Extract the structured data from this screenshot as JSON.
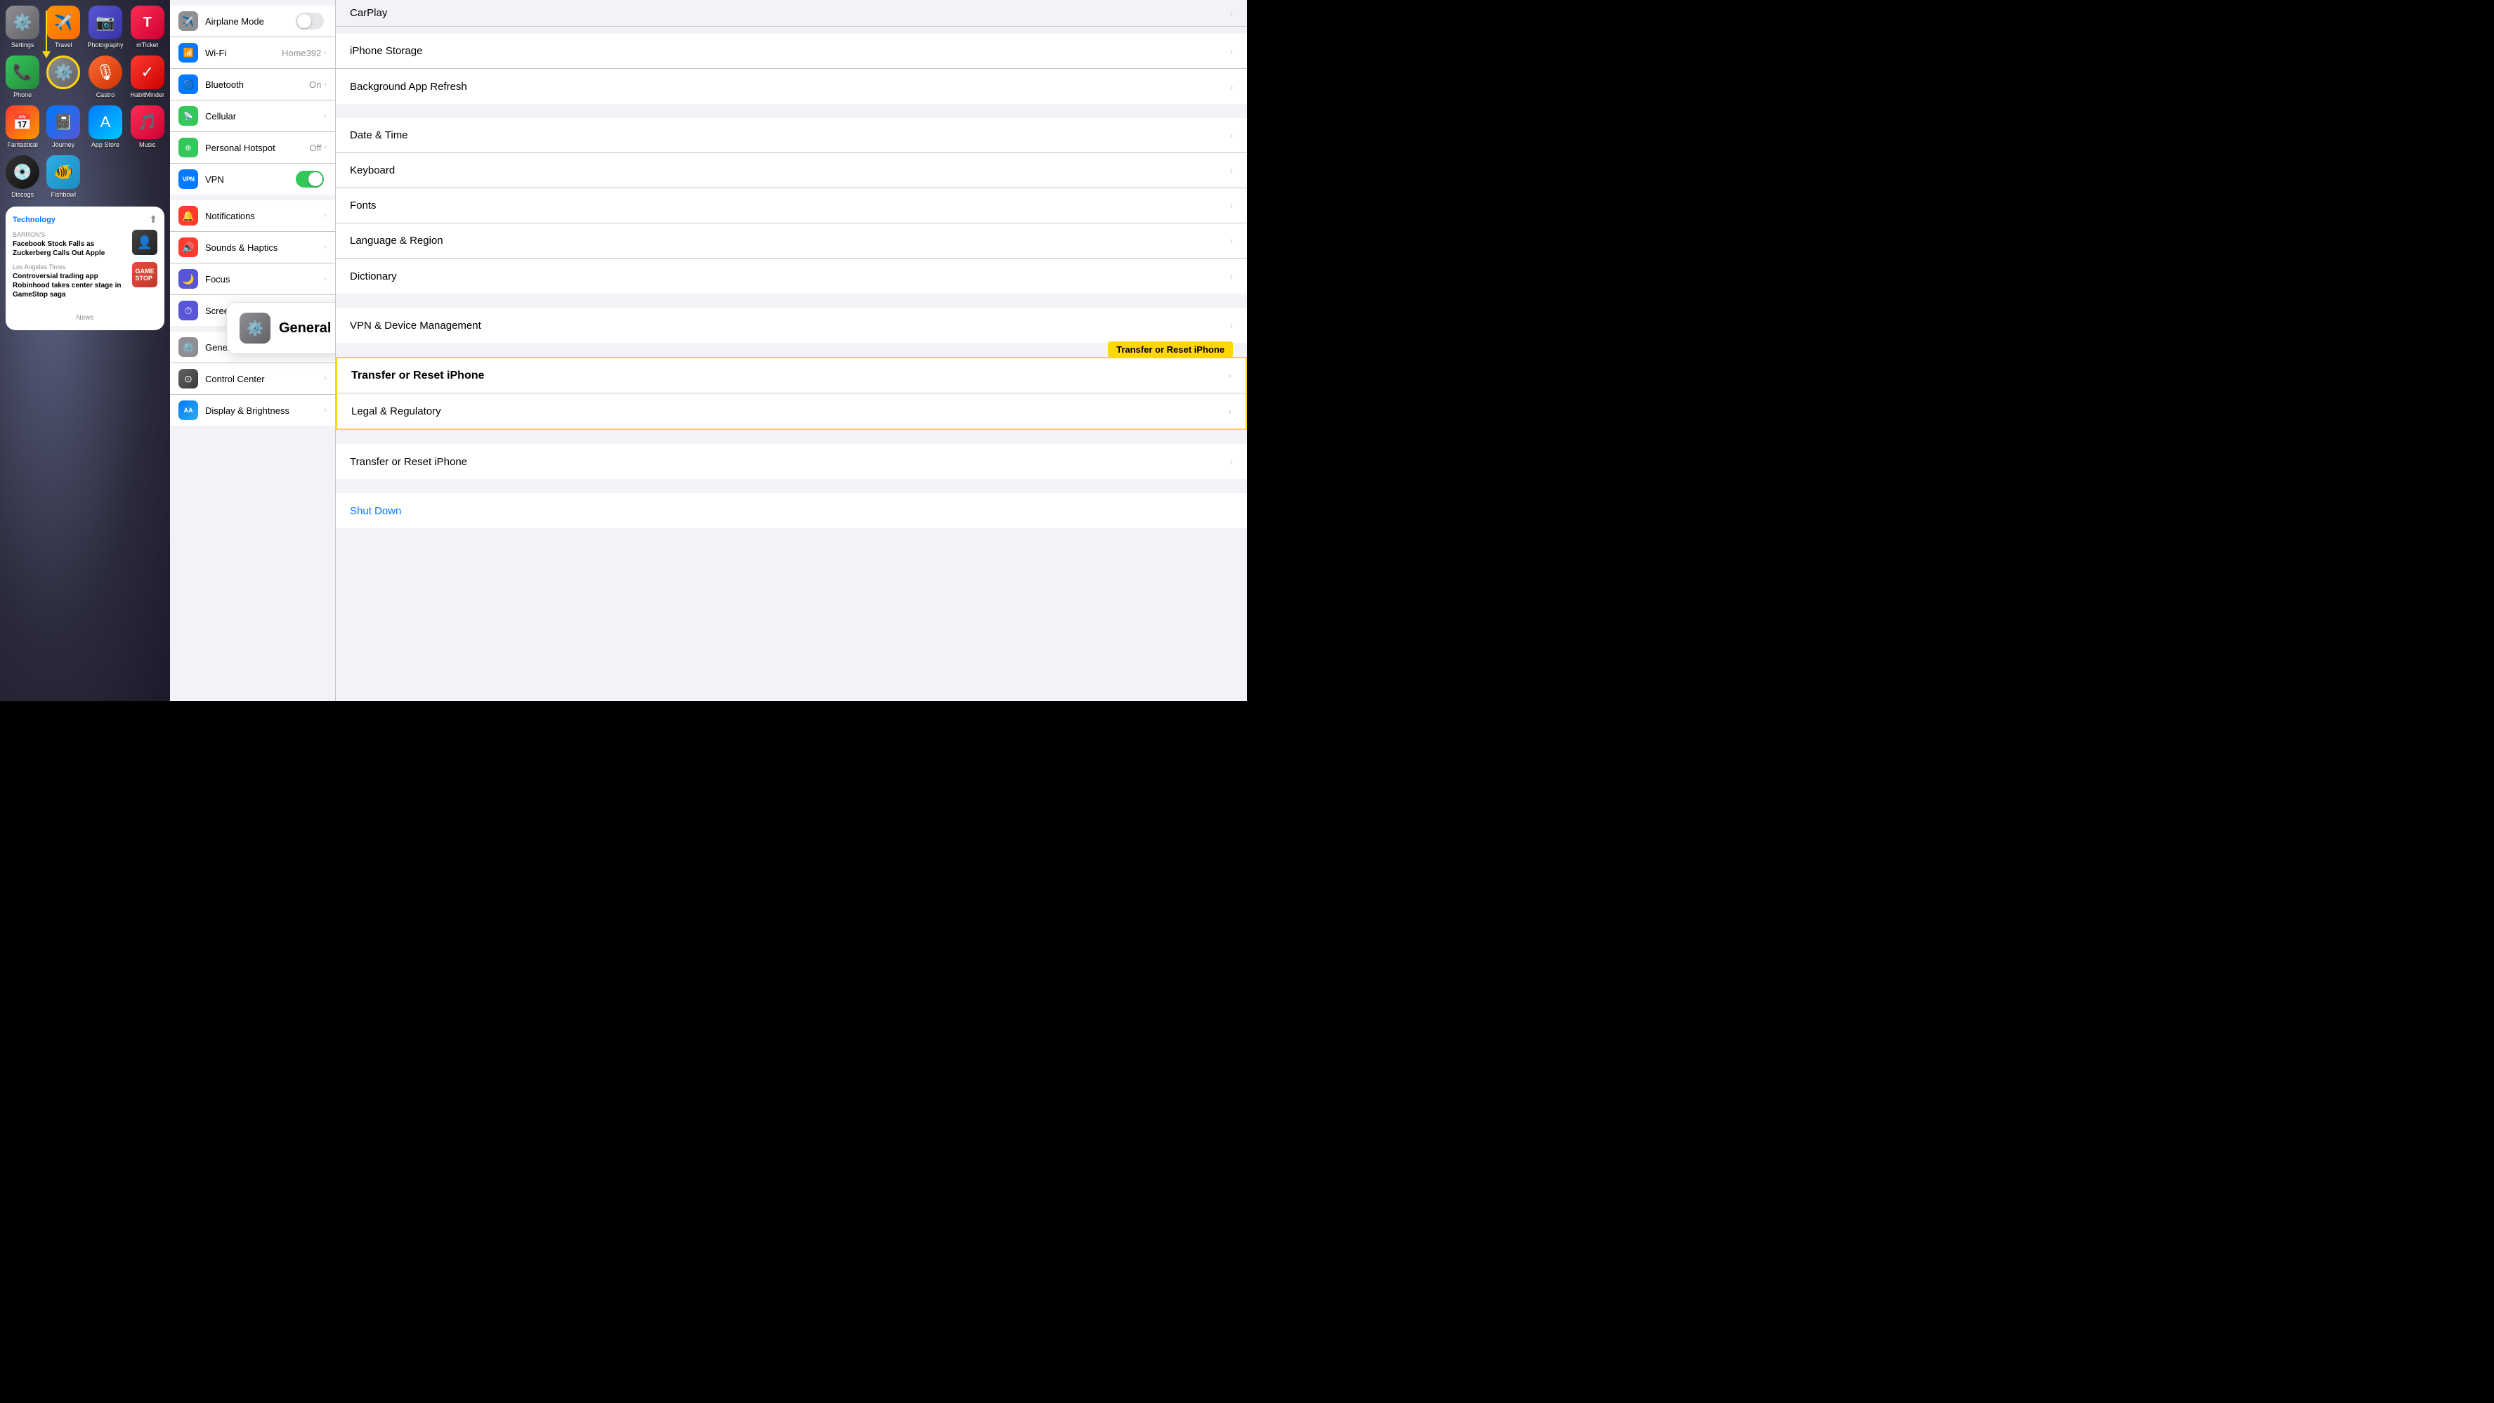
{
  "leftPanel": {
    "apps": [
      {
        "name": "Settings",
        "label": "Settings",
        "icon": "⚙️",
        "iconClass": "icon-settings"
      },
      {
        "name": "Travel",
        "label": "Travel",
        "icon": "✈️",
        "iconClass": "icon-travel"
      },
      {
        "name": "Photography",
        "label": "Photography",
        "icon": "📷",
        "iconClass": "icon-photography"
      },
      {
        "name": "mTicket",
        "label": "mTicket",
        "icon": "T",
        "iconClass": "icon-mticket"
      },
      {
        "name": "Phone",
        "label": "Phone",
        "icon": "📞",
        "iconClass": "icon-phone"
      },
      {
        "name": "SettingsHighlight",
        "label": "",
        "icon": "⚙️",
        "iconClass": "icon-settings-circled"
      },
      {
        "name": "Castro",
        "label": "Castro",
        "icon": "🎙",
        "iconClass": "icon-castro"
      },
      {
        "name": "HabitMinder",
        "label": "HabitMinder",
        "icon": "✓",
        "iconClass": "icon-habitminder"
      },
      {
        "name": "Fantastical",
        "label": "Fantastical",
        "icon": "📅",
        "iconClass": "icon-fantastical"
      },
      {
        "name": "Journey",
        "label": "Journey",
        "icon": "🐟",
        "iconClass": "icon-journey"
      },
      {
        "name": "AppStore",
        "label": "App Store",
        "icon": "A",
        "iconClass": "icon-appstore"
      },
      {
        "name": "Music",
        "label": "Music",
        "icon": "🎵",
        "iconClass": "icon-music"
      },
      {
        "name": "Discogs",
        "label": "Discogs",
        "icon": "💿",
        "iconClass": "icon-discogs"
      },
      {
        "name": "Fishbowl",
        "label": "Fishbowl",
        "icon": "🐠",
        "iconClass": "icon-fishbowl"
      }
    ],
    "news": {
      "category": "Technology",
      "source1": "BARRON'S",
      "headline1": "Facebook Stock Falls as Zuckerberg Calls Out Apple",
      "source2": "Los Angeles Times",
      "headline2": "Controversial trading app Robinhood takes center stage in GameStop saga",
      "widgetLabel": "News"
    },
    "pageDots": [
      false,
      true,
      false
    ]
  },
  "middlePanel": {
    "sections": [
      {
        "rows": [
          {
            "icon": "✈️",
            "iconClass": "icon-airplane",
            "label": "Airplane Mode",
            "type": "toggle-off",
            "value": "",
            "hasChevron": false
          },
          {
            "icon": "📶",
            "iconClass": "icon-wifi",
            "label": "Wi-Fi",
            "type": "value",
            "value": "Home392",
            "hasChevron": true
          },
          {
            "icon": "🔵",
            "iconClass": "icon-bluetooth",
            "label": "Bluetooth",
            "type": "value",
            "value": "On",
            "hasChevron": true
          },
          {
            "icon": "📡",
            "iconClass": "icon-cellular",
            "label": "Cellular",
            "type": "chevron",
            "value": "",
            "hasChevron": true
          },
          {
            "icon": "🔗",
            "iconClass": "icon-hotspot",
            "label": "Personal Hotspot",
            "type": "value",
            "value": "Off",
            "hasChevron": true
          },
          {
            "icon": "VPN",
            "iconClass": "icon-vpn",
            "label": "VPN",
            "type": "toggle-on",
            "value": "",
            "hasChevron": false
          }
        ]
      },
      {
        "rows": [
          {
            "icon": "🔔",
            "iconClass": "icon-notifications",
            "label": "Notifications",
            "type": "chevron",
            "value": "",
            "hasChevron": true
          },
          {
            "icon": "🔊",
            "iconClass": "icon-sounds",
            "label": "Sounds & Haptics",
            "type": "chevron",
            "value": "",
            "hasChevron": true
          },
          {
            "icon": "🌙",
            "iconClass": "icon-focus",
            "label": "Focus",
            "type": "chevron",
            "value": "",
            "hasChevron": true
          },
          {
            "icon": "⏱",
            "iconClass": "icon-screentime",
            "label": "Screen Time",
            "type": "chevron",
            "value": "",
            "hasChevron": true
          }
        ]
      },
      {
        "rows": [
          {
            "icon": "⚙️",
            "iconClass": "icon-general",
            "label": "General",
            "type": "chevron",
            "value": "",
            "hasChevron": true
          },
          {
            "icon": "⊙",
            "iconClass": "icon-controlcenter",
            "label": "Control Center",
            "type": "chevron",
            "value": "",
            "hasChevron": true
          },
          {
            "icon": "AA",
            "iconClass": "icon-display",
            "label": "Display & Brightness",
            "type": "chevron",
            "value": "",
            "hasChevron": true
          }
        ]
      }
    ],
    "generalTooltip": {
      "label": "General",
      "iconText": "⚙️"
    }
  },
  "rightPanel": {
    "topRow": {
      "label": "CarPlay",
      "hasChevron": true
    },
    "sections": [
      {
        "rows": [
          {
            "label": "iPhone Storage",
            "hasChevron": true
          },
          {
            "label": "Background App Refresh",
            "hasChevron": true
          }
        ]
      },
      {
        "rows": [
          {
            "label": "Date & Time",
            "hasChevron": true
          },
          {
            "label": "Keyboard",
            "hasChevron": true
          },
          {
            "label": "Fonts",
            "hasChevron": true
          },
          {
            "label": "Language & Region",
            "hasChevron": true
          },
          {
            "label": "Dictionary",
            "hasChevron": true
          }
        ]
      },
      {
        "rows": [
          {
            "label": "VPN & Device Management",
            "hasChevron": true
          }
        ]
      },
      {
        "rows": [
          {
            "label": "Transfer or Reset iPhone",
            "hasChevron": true,
            "highlight": true
          },
          {
            "label": "Legal & Regulatory",
            "hasChevron": true
          }
        ]
      },
      {
        "rows": [
          {
            "label": "Transfer or Reset iPhone",
            "hasChevron": true
          }
        ]
      },
      {
        "rows": [
          {
            "label": "Shut Down",
            "hasChevron": false,
            "isBlue": true
          }
        ]
      }
    ]
  }
}
